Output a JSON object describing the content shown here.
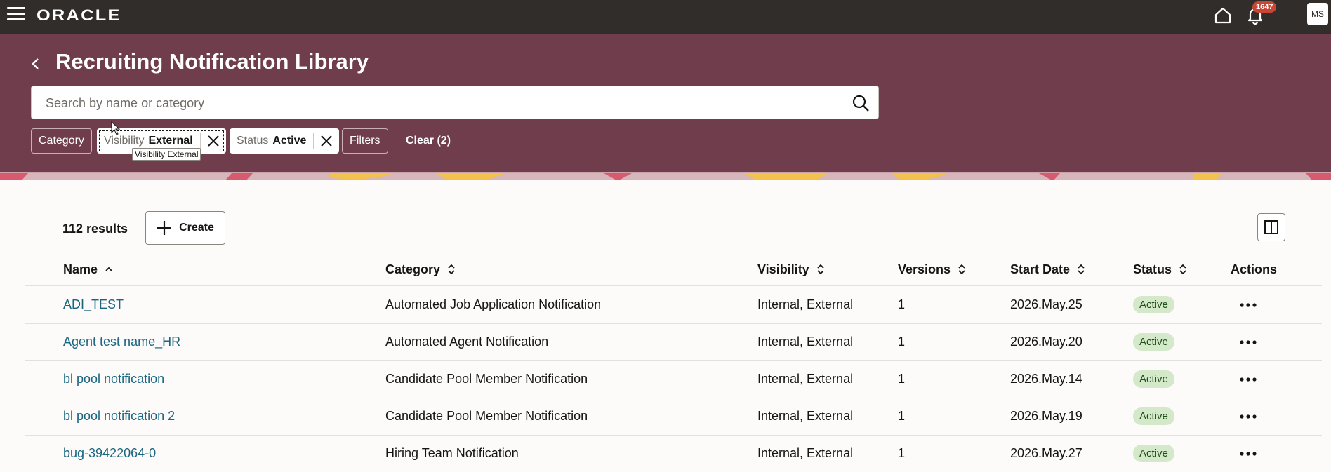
{
  "app": {
    "logo": "ORACLE",
    "notification_count": "1647",
    "user_initials": "MS"
  },
  "page": {
    "title": "Recruiting Notification Library"
  },
  "search": {
    "placeholder": "Search by name or category",
    "value": ""
  },
  "filters": {
    "category_label": "Category",
    "visibility": {
      "key": "Visibility",
      "value": "External"
    },
    "status": {
      "key": "Status",
      "value": "Active"
    },
    "filters_label": "Filters",
    "clear_label": "Clear (2)",
    "tooltip": "Visibility External"
  },
  "results": {
    "count_label": "112 results",
    "create_label": "Create"
  },
  "table": {
    "columns": [
      "Name",
      "Category",
      "Visibility",
      "Versions",
      "Start Date",
      "Status",
      "Actions"
    ],
    "rows": [
      {
        "name": "ADI_TEST",
        "category": "Automated Job Application Notification",
        "visibility": "Internal, External",
        "versions": "1",
        "start_date": "2026.May.25",
        "status": "Active"
      },
      {
        "name": "Agent test name_HR",
        "category": "Automated Agent Notification",
        "visibility": "Internal, External",
        "versions": "1",
        "start_date": "2026.May.20",
        "status": "Active"
      },
      {
        "name": "bl pool notification",
        "category": "Candidate Pool Member Notification",
        "visibility": "Internal, External",
        "versions": "1",
        "start_date": "2026.May.14",
        "status": "Active"
      },
      {
        "name": "bl pool notification 2",
        "category": "Candidate Pool Member Notification",
        "visibility": "Internal, External",
        "versions": "1",
        "start_date": "2026.May.19",
        "status": "Active"
      },
      {
        "name": "bug-39422064-0",
        "category": "Hiring Team Notification",
        "visibility": "Internal, External",
        "versions": "1",
        "start_date": "2026.May.27",
        "status": "Active"
      }
    ]
  },
  "colors": {
    "topbar": "#312d2a",
    "hero": "#6f3d4c",
    "link": "#1a6680",
    "badge": "#c74634",
    "status_bg": "#d4e9c9"
  }
}
